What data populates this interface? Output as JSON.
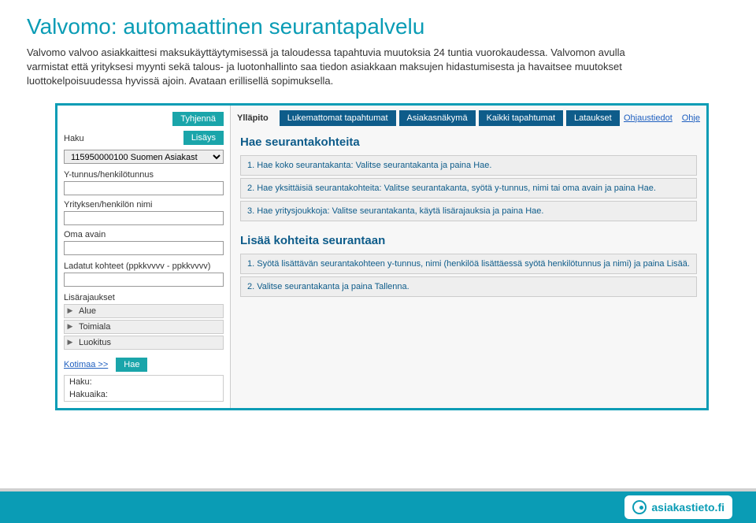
{
  "header": {
    "title": "Valvomo: automaattinen seurantapalvelu",
    "description": "Valvomo valvoo asiakkaittesi maksukäyttäytymisessä ja taloudessa tapahtuvia muutoksia 24 tuntia vuorokaudessa. Valvomon avulla varmistat että yrityksesi myynti sekä talous- ja luotonhallinto saa tiedon asiakkaan maksujen hidastumisesta ja havaitsee muutokset luottokelpoisuudessa hyvissä ajoin. Avataan erillisellä sopimuksella."
  },
  "sidebar": {
    "btn_clear": "Tyhjennä",
    "btn_add": "Lisäys",
    "haku_label": "Haku",
    "haku_value": "115950000100 Suomen Asiakast",
    "ytunnus_label": "Y-tunnus/henkilötunnus",
    "yritys_label": "Yrityksen/henkilön nimi",
    "oma_label": "Oma avain",
    "ladatut_label": "Ladatut kohteet (ppkkvvvv - ppkkvvvv)",
    "lisarajaukset_label": "Lisärajaukset",
    "filters": [
      {
        "label": "Alue"
      },
      {
        "label": "Toimiala"
      },
      {
        "label": "Luokitus"
      }
    ],
    "kotimaa_link": "Kotimaa >>",
    "btn_hae": "Hae",
    "status_haku": "Haku:",
    "status_hakuaika": "Hakuaika:"
  },
  "tabs": {
    "yllapito": "Ylläpito",
    "lukemattomat": "Lukemattomat tapahtumat",
    "asiakas": "Asiakasnäkymä",
    "kaikki": "Kaikki tapahtumat",
    "lataukset": "Lataukset"
  },
  "links": {
    "ohjaustiedot": "Ohjaustiedot",
    "ohje": "Ohje"
  },
  "content": {
    "section1_title": "Hae seurantakohteita",
    "section1_rows": [
      "1. Hae koko seurantakanta: Valitse seurantakanta ja paina Hae.",
      "2. Hae yksittäisiä seurantakohteita: Valitse seurantakanta, syötä y-tunnus, nimi tai oma avain ja paina Hae.",
      "3. Hae yritysjoukkoja: Valitse seurantakanta, käytä lisärajauksia ja paina Hae."
    ],
    "section2_title": "Lisää kohteita seurantaan",
    "section2_rows": [
      "1. Syötä lisättävän seurantakohteen y-tunnus, nimi (henkilöä lisättäessä syötä henkilötunnus ja nimi) ja paina Lisää.",
      "2. Valitse seurantakanta ja paina Tallenna."
    ]
  },
  "footer": {
    "brand": "asiakastieto.fi"
  }
}
